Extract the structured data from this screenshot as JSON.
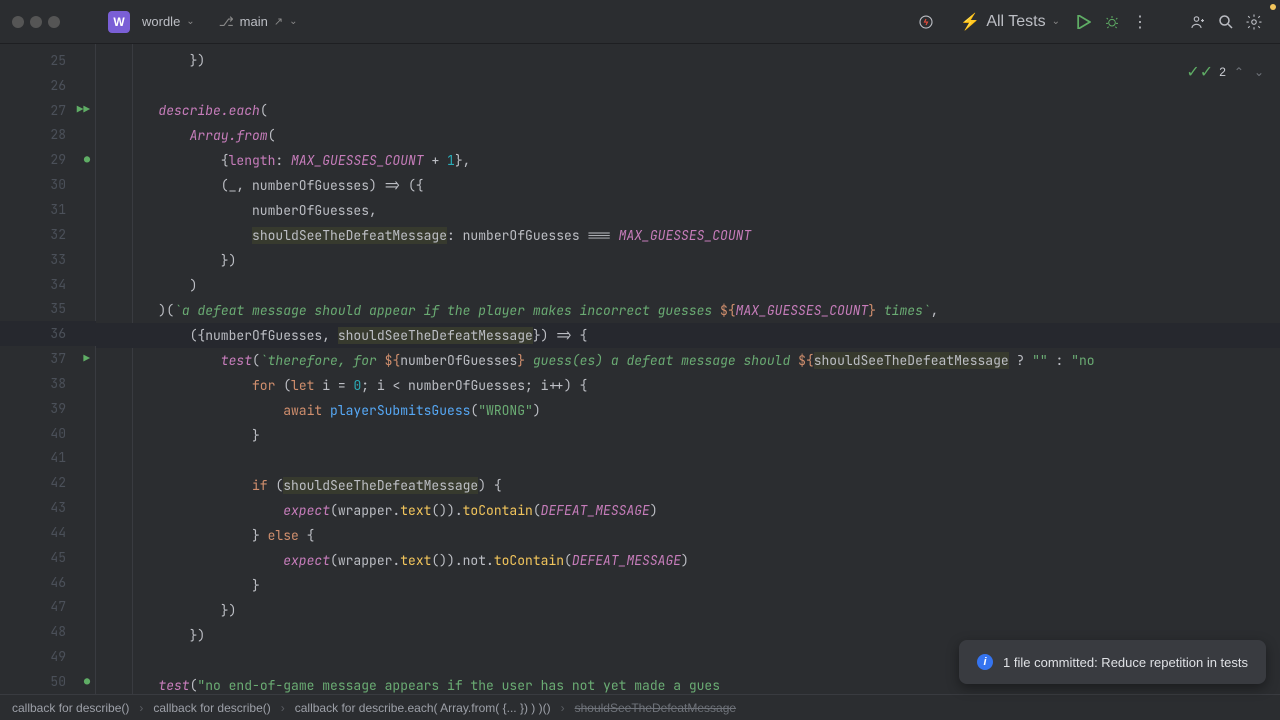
{
  "toolbar": {
    "project_letter": "W",
    "project_name": "wordle",
    "branch_name": "main",
    "run_config": "All Tests"
  },
  "hints": {
    "count": "2"
  },
  "gutter": {
    "start": 25,
    "end": 50,
    "icons": {
      "27": "run-double",
      "29": "change",
      "36": "bulb",
      "37": "run",
      "50": "change"
    }
  },
  "code": {
    "l25": "            })",
    "l26": "",
    "l27_a": "        describe",
    "l27_b": ".each",
    "l27_c": "(",
    "l28_a": "            Array",
    "l28_b": ".from",
    "l28_c": "(",
    "l29_a": "                {",
    "l29_b": "length",
    "l29_c": ": ",
    "l29_d": "MAX_GUESSES_COUNT",
    "l29_e": " + ",
    "l29_f": "1",
    "l29_g": "},",
    "l30_a": "                (_, numberOfGuesses) => ({",
    "l31_a": "                    numberOfGuesses,",
    "l32_a": "                    ",
    "l32_b": "shouldSeeTheDefeatMessage",
    "l32_c": ": numberOfGuesses === ",
    "l32_d": "MAX_GUESSES_COUNT",
    "l33_a": "                })",
    "l34_a": "            )",
    "l35_a": "        )(",
    "l35_b": "`a defeat message should appear if the player makes incorrect guesses ",
    "l35_c": "${",
    "l35_d": "MAX_GUESSES_COUNT",
    "l35_e": "}",
    "l35_f": " times`",
    "l35_g": ",",
    "l36_a": "            ({numberOfGuesses, ",
    "l36_b": "shouldSeeTheDefeatMessage",
    "l36_c": "}) => {",
    "l37_a": "                test",
    "l37_b": "(",
    "l37_c": "`therefore, for ",
    "l37_d": "${",
    "l37_e": "numberOfGuesses",
    "l37_f": "}",
    "l37_g": " guess(es) a defeat message should ",
    "l37_h": "${",
    "l37_i": "shouldSeeTheDefeatMessage",
    "l37_j": " ? ",
    "l37_k": "\"\"",
    "l37_l": " : ",
    "l37_m": "\"no",
    "l38_a": "                    for",
    "l38_b": " (",
    "l38_c": "let",
    "l38_d": " i = ",
    "l38_e": "0",
    "l38_f": "; i < numberOfGuesses; i++) {",
    "l39_a": "                        await",
    "l39_b": " ",
    "l39_c": "playerSubmitsGuess",
    "l39_d": "(",
    "l39_e": "\"WRONG\"",
    "l39_f": ")",
    "l40_a": "                    }",
    "l41_a": "",
    "l42_a": "                    if",
    "l42_b": " (",
    "l42_c": "shouldSeeTheDefeatMessage",
    "l42_d": ") {",
    "l43_a": "                        expect",
    "l43_b": "(wrapper.",
    "l43_c": "text",
    "l43_d": "()).",
    "l43_e": "toContain",
    "l43_f": "(",
    "l43_g": "DEFEAT_MESSAGE",
    "l43_h": ")",
    "l44_a": "                    } ",
    "l44_b": "else",
    "l44_c": " {",
    "l45_a": "                        expect",
    "l45_b": "(wrapper.",
    "l45_c": "text",
    "l45_d": "()).not.",
    "l45_e": "toContain",
    "l45_f": "(",
    "l45_g": "DEFEAT_MESSAGE",
    "l45_h": ")",
    "l46_a": "                    }",
    "l47_a": "                })",
    "l48_a": "            })",
    "l49_a": "",
    "l50_a": "        test",
    "l50_b": "(",
    "l50_c": "\"no end-of-game message appears if the user has not yet made a gues"
  },
  "notification": {
    "message": "1 file committed: Reduce repetition in tests"
  },
  "breadcrumbs": {
    "items": [
      "callback for describe()",
      "callback for describe()",
      "callback for describe.each( Array.from( {... }) ) )()",
      "shouldSeeTheDefeatMessage"
    ]
  }
}
